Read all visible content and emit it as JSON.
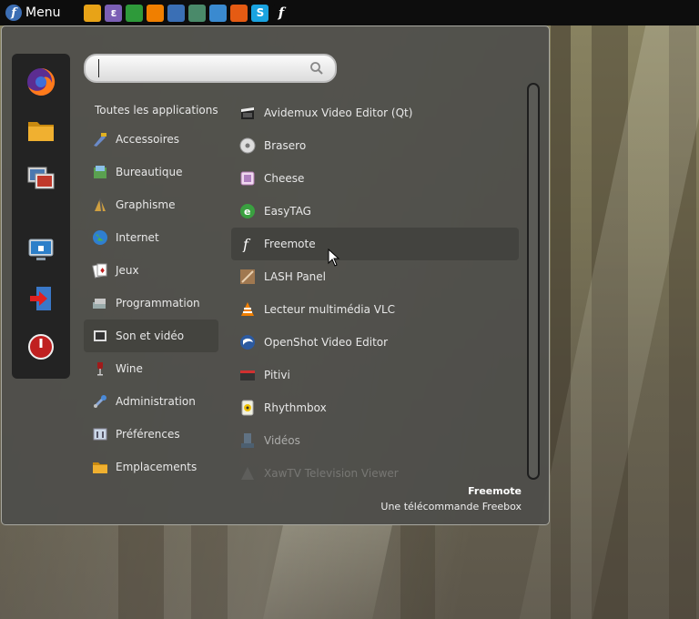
{
  "panel": {
    "menu_label": "Menu",
    "launchers": [
      {
        "icon": "folder-icon",
        "color": "#e8a317",
        "glyph": ""
      },
      {
        "icon": "emacs-icon",
        "color": "#7b5fb5",
        "glyph": "ε"
      },
      {
        "icon": "spreadsheet-icon",
        "color": "#2e9a3a",
        "glyph": ""
      },
      {
        "icon": "vlc-icon",
        "color": "#f07f00",
        "glyph": ""
      },
      {
        "icon": "image-viewer-icon",
        "color": "#3a6fb5",
        "glyph": ""
      },
      {
        "icon": "monitor-icon",
        "color": "#4a8a6a",
        "glyph": ""
      },
      {
        "icon": "window-icon",
        "color": "#3a8ad0",
        "glyph": ""
      },
      {
        "icon": "firefox-icon",
        "color": "#e55b13",
        "glyph": ""
      },
      {
        "icon": "skype-icon",
        "color": "#1aa3e0",
        "glyph": "S"
      },
      {
        "icon": "freemote-icon",
        "color": "#0d0d0d",
        "glyph": "f"
      }
    ]
  },
  "search": {
    "placeholder": "",
    "value": ""
  },
  "categories": {
    "all_label": "Toutes les applications",
    "items": [
      {
        "label": "Accessoires",
        "icon": "accessories-icon",
        "active": false
      },
      {
        "label": "Bureautique",
        "icon": "office-icon",
        "active": false
      },
      {
        "label": "Graphisme",
        "icon": "graphics-icon",
        "active": false
      },
      {
        "label": "Internet",
        "icon": "internet-icon",
        "active": false
      },
      {
        "label": "Jeux",
        "icon": "games-icon",
        "active": false
      },
      {
        "label": "Programmation",
        "icon": "programming-icon",
        "active": false
      },
      {
        "label": "Son et vidéo",
        "icon": "multimedia-icon",
        "active": true
      },
      {
        "label": "Wine",
        "icon": "wine-icon",
        "active": false
      },
      {
        "label": "Administration",
        "icon": "administration-icon",
        "active": false
      },
      {
        "label": "Préférences",
        "icon": "preferences-icon",
        "active": false
      },
      {
        "label": "Emplacements",
        "icon": "places-icon",
        "active": false
      }
    ]
  },
  "apps": [
    {
      "label": "Avidemux Video Editor (Qt)",
      "icon": "avidemux-icon"
    },
    {
      "label": "Brasero",
      "icon": "brasero-icon"
    },
    {
      "label": "Cheese",
      "icon": "cheese-icon"
    },
    {
      "label": "EasyTAG",
      "icon": "easytag-icon"
    },
    {
      "label": "Freemote",
      "icon": "freemote-icon",
      "hover": true
    },
    {
      "label": "LASH Panel",
      "icon": "lash-panel-icon"
    },
    {
      "label": "Lecteur multimédia VLC",
      "icon": "vlc-icon"
    },
    {
      "label": "OpenShot Video Editor",
      "icon": "openshot-icon"
    },
    {
      "label": "Pitivi",
      "icon": "pitivi-icon"
    },
    {
      "label": "Rhythmbox",
      "icon": "rhythmbox-icon"
    },
    {
      "label": "Vidéos",
      "icon": "videos-icon",
      "dim": true
    },
    {
      "label": "XawTV Television Viewer",
      "icon": "xawtv-icon",
      "faded": true
    }
  ],
  "description": {
    "title": "Freemote",
    "subtitle": "Une télécommande Freebox"
  }
}
